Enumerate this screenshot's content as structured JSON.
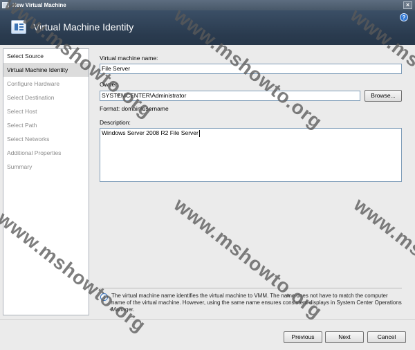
{
  "window": {
    "title": "New Virtual Machine"
  },
  "header": {
    "heading": "Virtual Machine Identity"
  },
  "sidebar": {
    "items": [
      {
        "label": "Select Source"
      },
      {
        "label": "Virtual Machine Identity"
      },
      {
        "label": "Configure Hardware"
      },
      {
        "label": "Select Destination"
      },
      {
        "label": "Select Host"
      },
      {
        "label": "Select Path"
      },
      {
        "label": "Select Networks"
      },
      {
        "label": "Additional Properties"
      },
      {
        "label": "Summary"
      }
    ]
  },
  "form": {
    "vm_name_label": "Virtual machine name:",
    "vm_name_value": "File Server",
    "owner_label": "Owner:",
    "owner_value": "SYSTEMCENTER\\Administrator",
    "browse_label": "Browse...",
    "format_hint": "Format: domain\\username",
    "description_label": "Description:",
    "description_value": "Windows Server 2008 R2 File Server"
  },
  "info": {
    "text": "The virtual machine name identifies the virtual machine to VMM. The name does not have to match the computer name of the virtual machine. However, using the same name ensures consistent displays in System Center Operations Manager."
  },
  "buttons": {
    "previous": "Previous",
    "next": "Next",
    "cancel": "Cancel"
  },
  "watermark": {
    "text": "www.mshowto.org"
  }
}
